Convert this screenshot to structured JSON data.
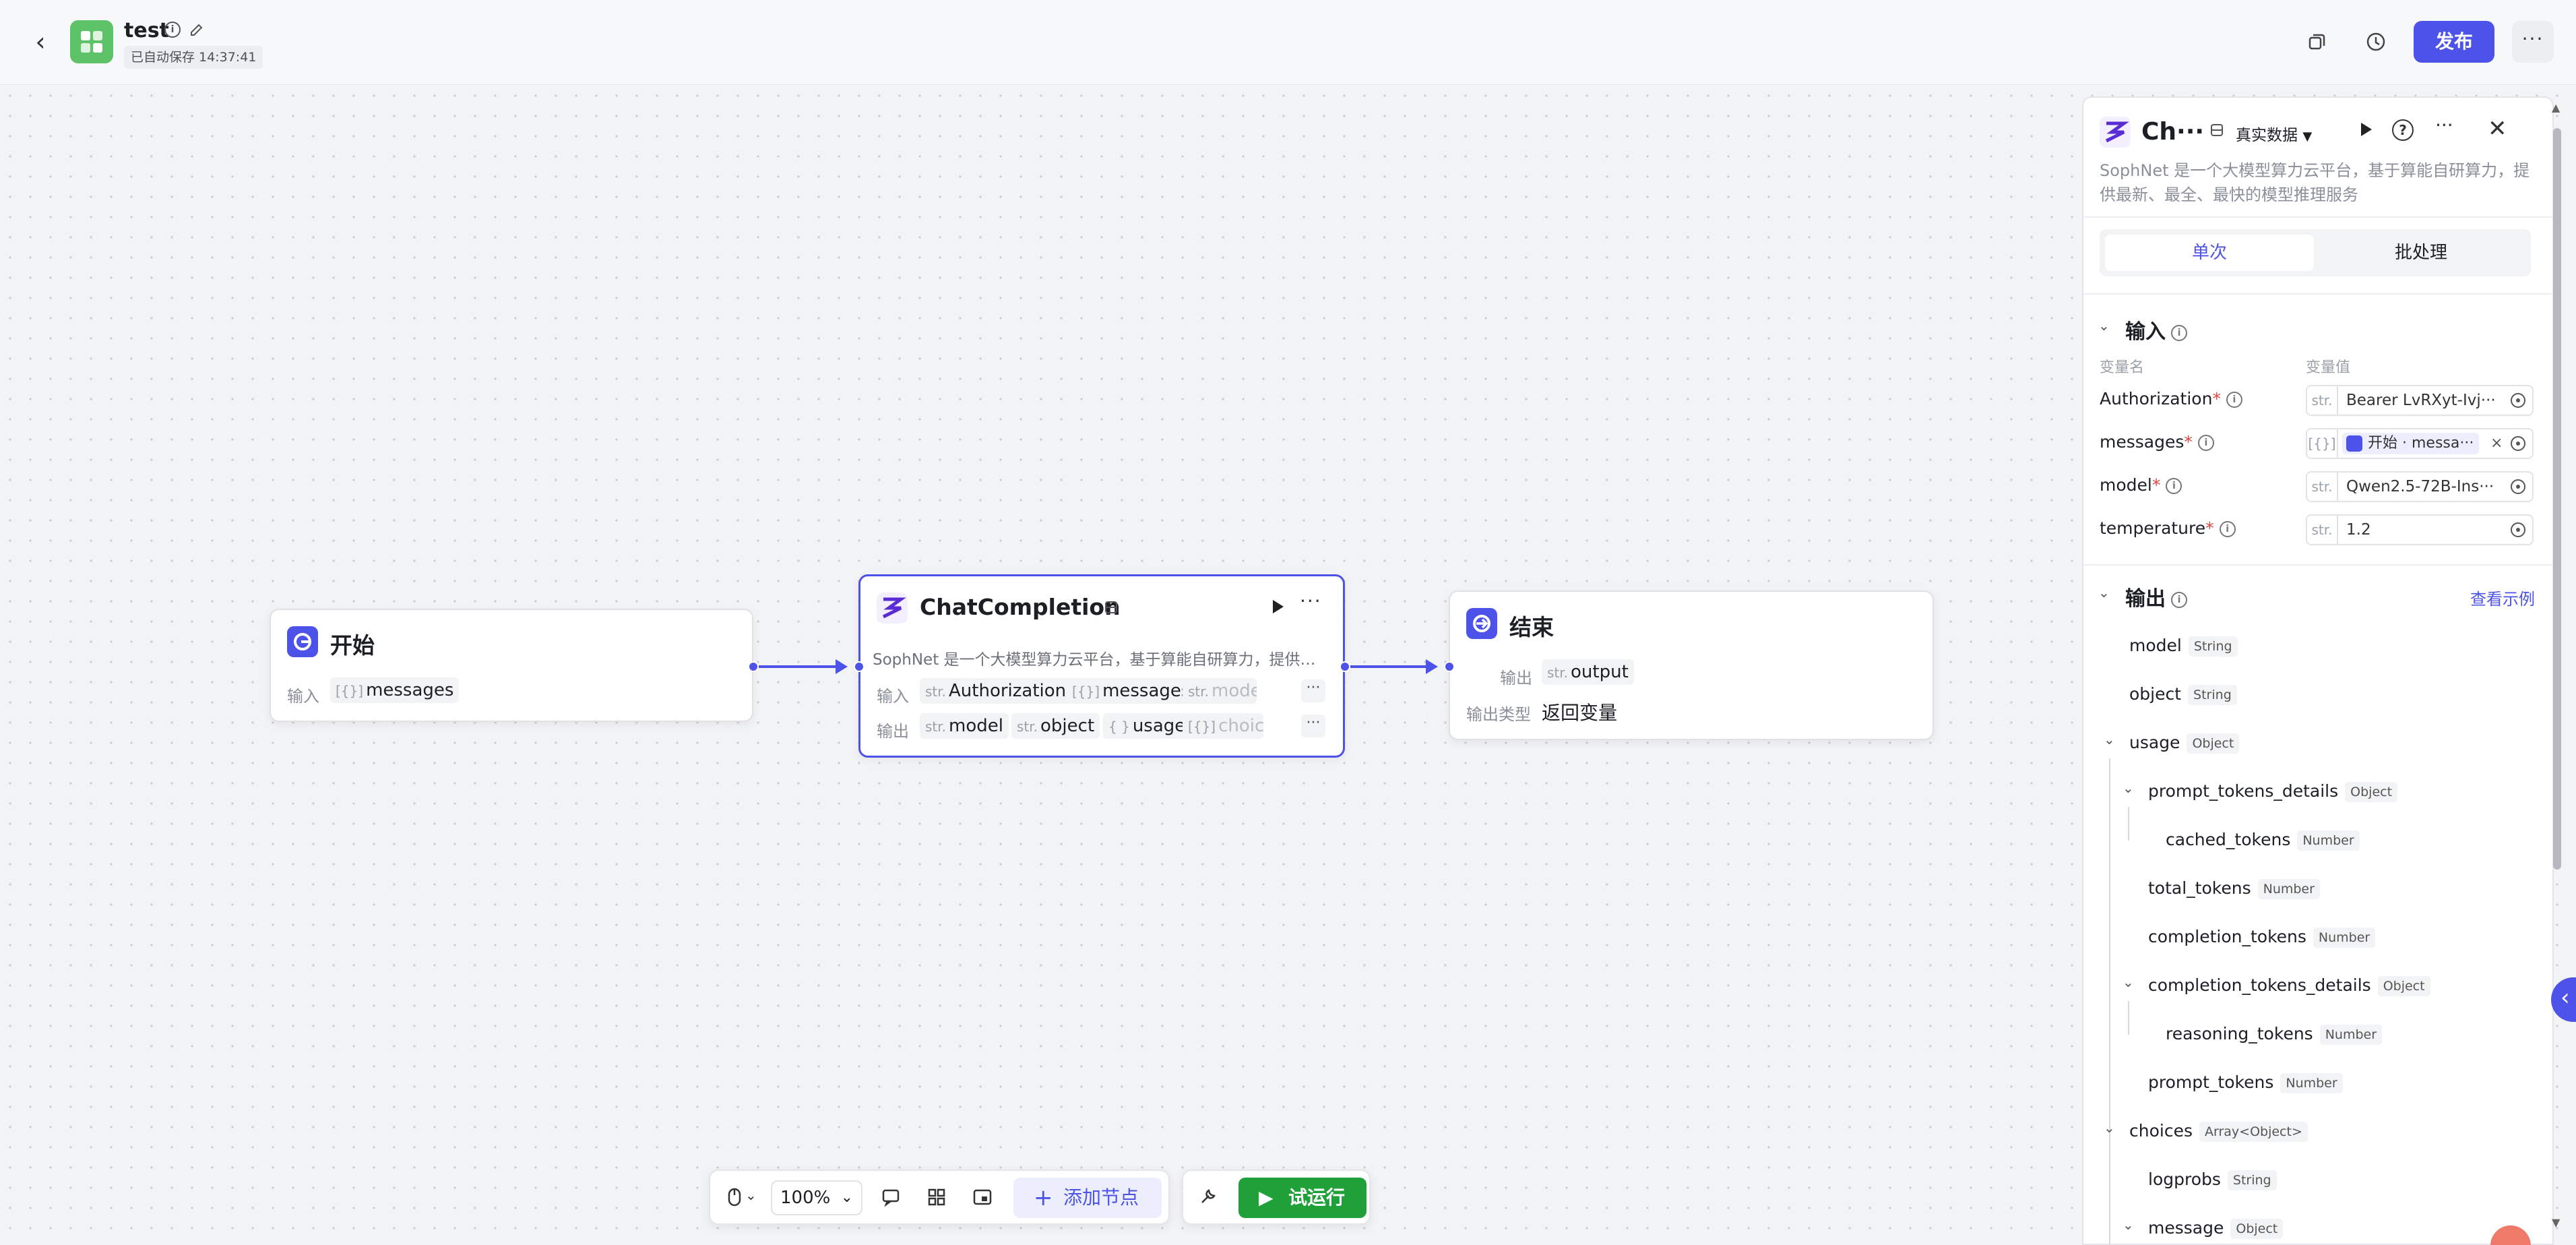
{
  "header": {
    "app_title": "test",
    "autosave_text": "已自动保存 14:37:41",
    "publish_label": "发布",
    "more_label": "···"
  },
  "canvas": {
    "start_node": {
      "title": "开始",
      "input_label": "输入",
      "input_tag_type": "[{}]",
      "input_tag_name": "messages"
    },
    "chat_node": {
      "title": "ChatCompletion",
      "description": "SophNet 是一个大模型算力云平台，基于算能自研算力，提供…",
      "input_label": "输入",
      "output_label": "输出",
      "inputs": [
        {
          "type": "str.",
          "name": "Authorization"
        },
        {
          "type": "[{}]",
          "name": "messages"
        },
        {
          "type": "str.",
          "name": "model"
        }
      ],
      "outputs": [
        {
          "type": "str.",
          "name": "model"
        },
        {
          "type": "str.",
          "name": "object"
        },
        {
          "type": "{ }",
          "name": "usage"
        },
        {
          "type": "[{}]",
          "name": "choices"
        }
      ],
      "more_label": "···"
    },
    "end_node": {
      "title": "结束",
      "output_label": "输出",
      "output_tag_type": "str.",
      "output_tag_name": "output",
      "output_type_label": "输出类型",
      "output_type_value": "返回变量"
    }
  },
  "toolbar": {
    "zoom": "100%",
    "add_node_label": "添加节点",
    "run_label": "试运行"
  },
  "panel": {
    "title": "Ch···",
    "data_mode": "真实数据",
    "description": "SophNet 是一个大模型算力云平台，基于算能自研算力，提供最新、最全、最快的模型推理服务",
    "tabs": [
      "单次",
      "批处理"
    ],
    "input_section": {
      "title": "输入",
      "col_name": "变量名",
      "col_value": "变量值",
      "rows": [
        {
          "name": "Authorization",
          "type": "str.",
          "value": "Bearer LvRXyt-Ivj···"
        },
        {
          "name": "messages",
          "type": "[{}]",
          "ref_value": "开始 · messa···"
        },
        {
          "name": "model",
          "type": "str.",
          "value": "Qwen2.5-72B-Ins···"
        },
        {
          "name": "temperature",
          "type": "str.",
          "value": "1.2"
        }
      ]
    },
    "output_section": {
      "title": "输出",
      "view_example": "查看示例",
      "items": [
        {
          "name": "model",
          "type": "String"
        },
        {
          "name": "object",
          "type": "String"
        },
        {
          "name": "usage",
          "type": "Object"
        },
        {
          "name": "prompt_tokens_details",
          "type": "Object"
        },
        {
          "name": "cached_tokens",
          "type": "Number"
        },
        {
          "name": "total_tokens",
          "type": "Number"
        },
        {
          "name": "completion_tokens",
          "type": "Number"
        },
        {
          "name": "completion_tokens_details",
          "type": "Object"
        },
        {
          "name": "reasoning_tokens",
          "type": "Number"
        },
        {
          "name": "prompt_tokens",
          "type": "Number"
        },
        {
          "name": "choices",
          "type": "Array<Object>"
        },
        {
          "name": "logprobs",
          "type": "String"
        },
        {
          "name": "message",
          "type": "Object"
        }
      ]
    }
  },
  "colors": {
    "accent": "#4d53e8",
    "run_green": "#1fa038",
    "app_logo": "#5ec269"
  }
}
